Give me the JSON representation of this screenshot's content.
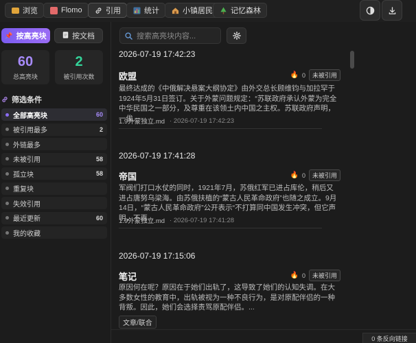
{
  "tabs": [
    {
      "label": "浏览",
      "icon": "folder-icon",
      "color": "#e0a43a"
    },
    {
      "label": "Flomo",
      "icon": "document-icon",
      "color": "#e36a6a"
    },
    {
      "label": "引用",
      "icon": "link-icon",
      "color": "#d6d6d6"
    },
    {
      "label": "统计",
      "icon": "bar-chart-icon",
      "color": "#5b9bd5"
    },
    {
      "label": "小镇居民",
      "icon": "house-icon",
      "color": "#d99a4e"
    },
    {
      "label": "记忆森林",
      "icon": "tree-icon",
      "color": "#4caf50"
    }
  ],
  "active_tab": "引用",
  "toolbar": {
    "theme_icon": "contrast-icon",
    "download_icon": "download-icon"
  },
  "mode": {
    "block_label": "按高亮块",
    "doc_label": "按文档"
  },
  "stats": {
    "total": {
      "value": "60",
      "label": "总高亮块",
      "color": "#a78bfa"
    },
    "referenced": {
      "value": "2",
      "label": "被引用次数",
      "color": "#34d399"
    }
  },
  "filter_title": "筛选条件",
  "filters": [
    {
      "label": "全部高亮块",
      "count": "60",
      "active": true
    },
    {
      "label": "被引用最多",
      "count": "2"
    },
    {
      "label": "外链最多",
      "count": ""
    },
    {
      "label": "未被引用",
      "count": "58"
    },
    {
      "label": "孤立块",
      "count": "58"
    },
    {
      "label": "重复块",
      "count": ""
    },
    {
      "label": "失效引用",
      "count": ""
    },
    {
      "label": "最近更新",
      "count": "60"
    },
    {
      "label": "我的收藏",
      "count": ""
    }
  ],
  "search": {
    "placeholder": "搜索高亮块内容..."
  },
  "entries": [
    {
      "time": "2026-07-19 17:42:23",
      "title": "欧盟",
      "refs": "0",
      "badge": "未被引用",
      "body": "最终达成的《中俄解决悬案大纲协定》由外交总长顾维钧与加拉罕于1924年5月31日签订。关于外蒙问题规定：“苏联政府承认外蒙为完全中华民国之一部分，及尊重在该领土内中国之主权。苏联政府声明，一俟...",
      "file": "1.9外蒙独立.md",
      "date": "2026-07-19 17:42:23"
    },
    {
      "time": "2026-07-19 17:41:28",
      "title": "帝国",
      "refs": "0",
      "badge": "未被引用",
      "body": "军阀们打口水仗的同时，1921年7月，苏俄红军已进占库伦，稍后又进占唐努乌梁海。由苏俄扶植的“蒙古人民革命政府”也随之成立。9月14日，“蒙古人民革命政府”公开表示“不打算同中国发生冲突，但它声明，不再...",
      "file": "1.9外蒙独立.md",
      "date": "2026-07-19 17:41:28"
    },
    {
      "time": "2026-07-19 17:15:06",
      "title": "笔记",
      "refs": "0",
      "badge": "未被引用",
      "body": "原因何在呢？原因在于她们出轨了，这导致了她们的认知失调。在大多数女性的教育中，出轨被视为一种不良行为，是对原配伴侣的一种背叛。因此，她们会选择责骂原配伴侣。...",
      "tag": "文章/联合"
    }
  ],
  "footer": {
    "backlinks": "0 条反向链接"
  }
}
